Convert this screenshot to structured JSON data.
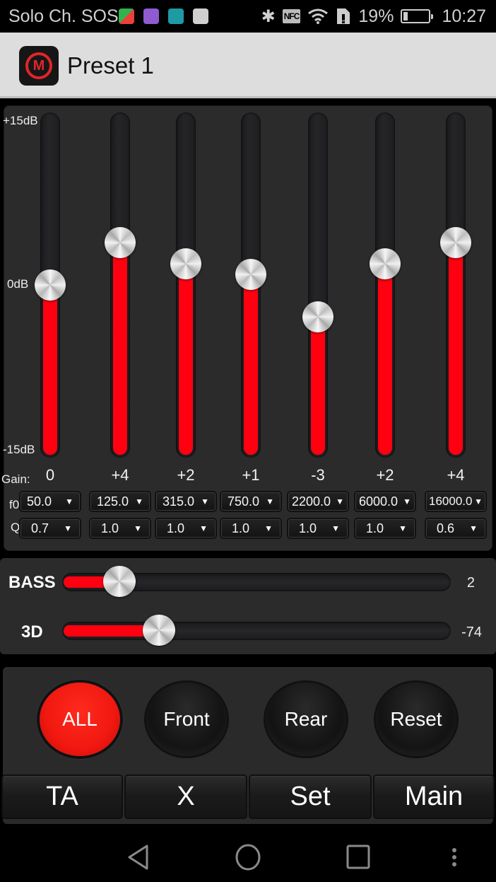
{
  "status_bar": {
    "carrier": "Solo Ch. SOS",
    "notification_icons": [
      {
        "name": "google-play-games-icon",
        "color": "#3aa856"
      },
      {
        "name": "gallery-icon",
        "color": "#8f5bd0"
      },
      {
        "name": "shield-app-icon",
        "color": "#1e9aa5"
      },
      {
        "name": "play-store-icon",
        "color": "#d0d0d0"
      }
    ],
    "nfc_label": "NFC",
    "battery_percent": "19%",
    "battery_level": 0.19,
    "time": "10:27"
  },
  "title_bar": {
    "app_icon_glyph": "M",
    "title": "Preset 1"
  },
  "equalizer": {
    "scale": {
      "max_label": "+15dB",
      "mid_label": "0dB",
      "min_label": "-15dB",
      "min": -15,
      "max": 15
    },
    "row_labels": {
      "gain": "Gain:",
      "f0": "f0:",
      "q": "Q:"
    },
    "bands": [
      {
        "gain": 0,
        "gain_label": "0",
        "f0": "50.0",
        "q": "0.7"
      },
      {
        "gain": 4,
        "gain_label": "+4",
        "f0": "125.0",
        "q": "1.0"
      },
      {
        "gain": 2,
        "gain_label": "+2",
        "f0": "315.0",
        "q": "1.0"
      },
      {
        "gain": 1,
        "gain_label": "+1",
        "f0": "750.0",
        "q": "1.0"
      },
      {
        "gain": -3,
        "gain_label": "-3",
        "f0": "2200.0",
        "q": "1.0"
      },
      {
        "gain": 2,
        "gain_label": "+2",
        "f0": "6000.0",
        "q": "1.0"
      },
      {
        "gain": 4,
        "gain_label": "+4",
        "f0": "16000.0",
        "q": "0.6"
      }
    ],
    "dropdown_arrow": "▼"
  },
  "effects": {
    "bass": {
      "label": "BASS",
      "value": "2",
      "fraction": 0.12
    },
    "three_d": {
      "label": "3D",
      "value": "-74",
      "fraction": 0.23
    }
  },
  "channel_buttons": [
    {
      "label": "ALL",
      "active": true
    },
    {
      "label": "Front",
      "active": false
    },
    {
      "label": "Rear",
      "active": false
    },
    {
      "label": "Reset",
      "active": false
    }
  ],
  "tab_buttons": [
    {
      "label": "TA"
    },
    {
      "label": "X"
    },
    {
      "label": "Set"
    },
    {
      "label": "Main"
    }
  ],
  "colors": {
    "accent": "#ff0010",
    "panel": "#2b2b2b",
    "titlebar": "#dddddd"
  }
}
